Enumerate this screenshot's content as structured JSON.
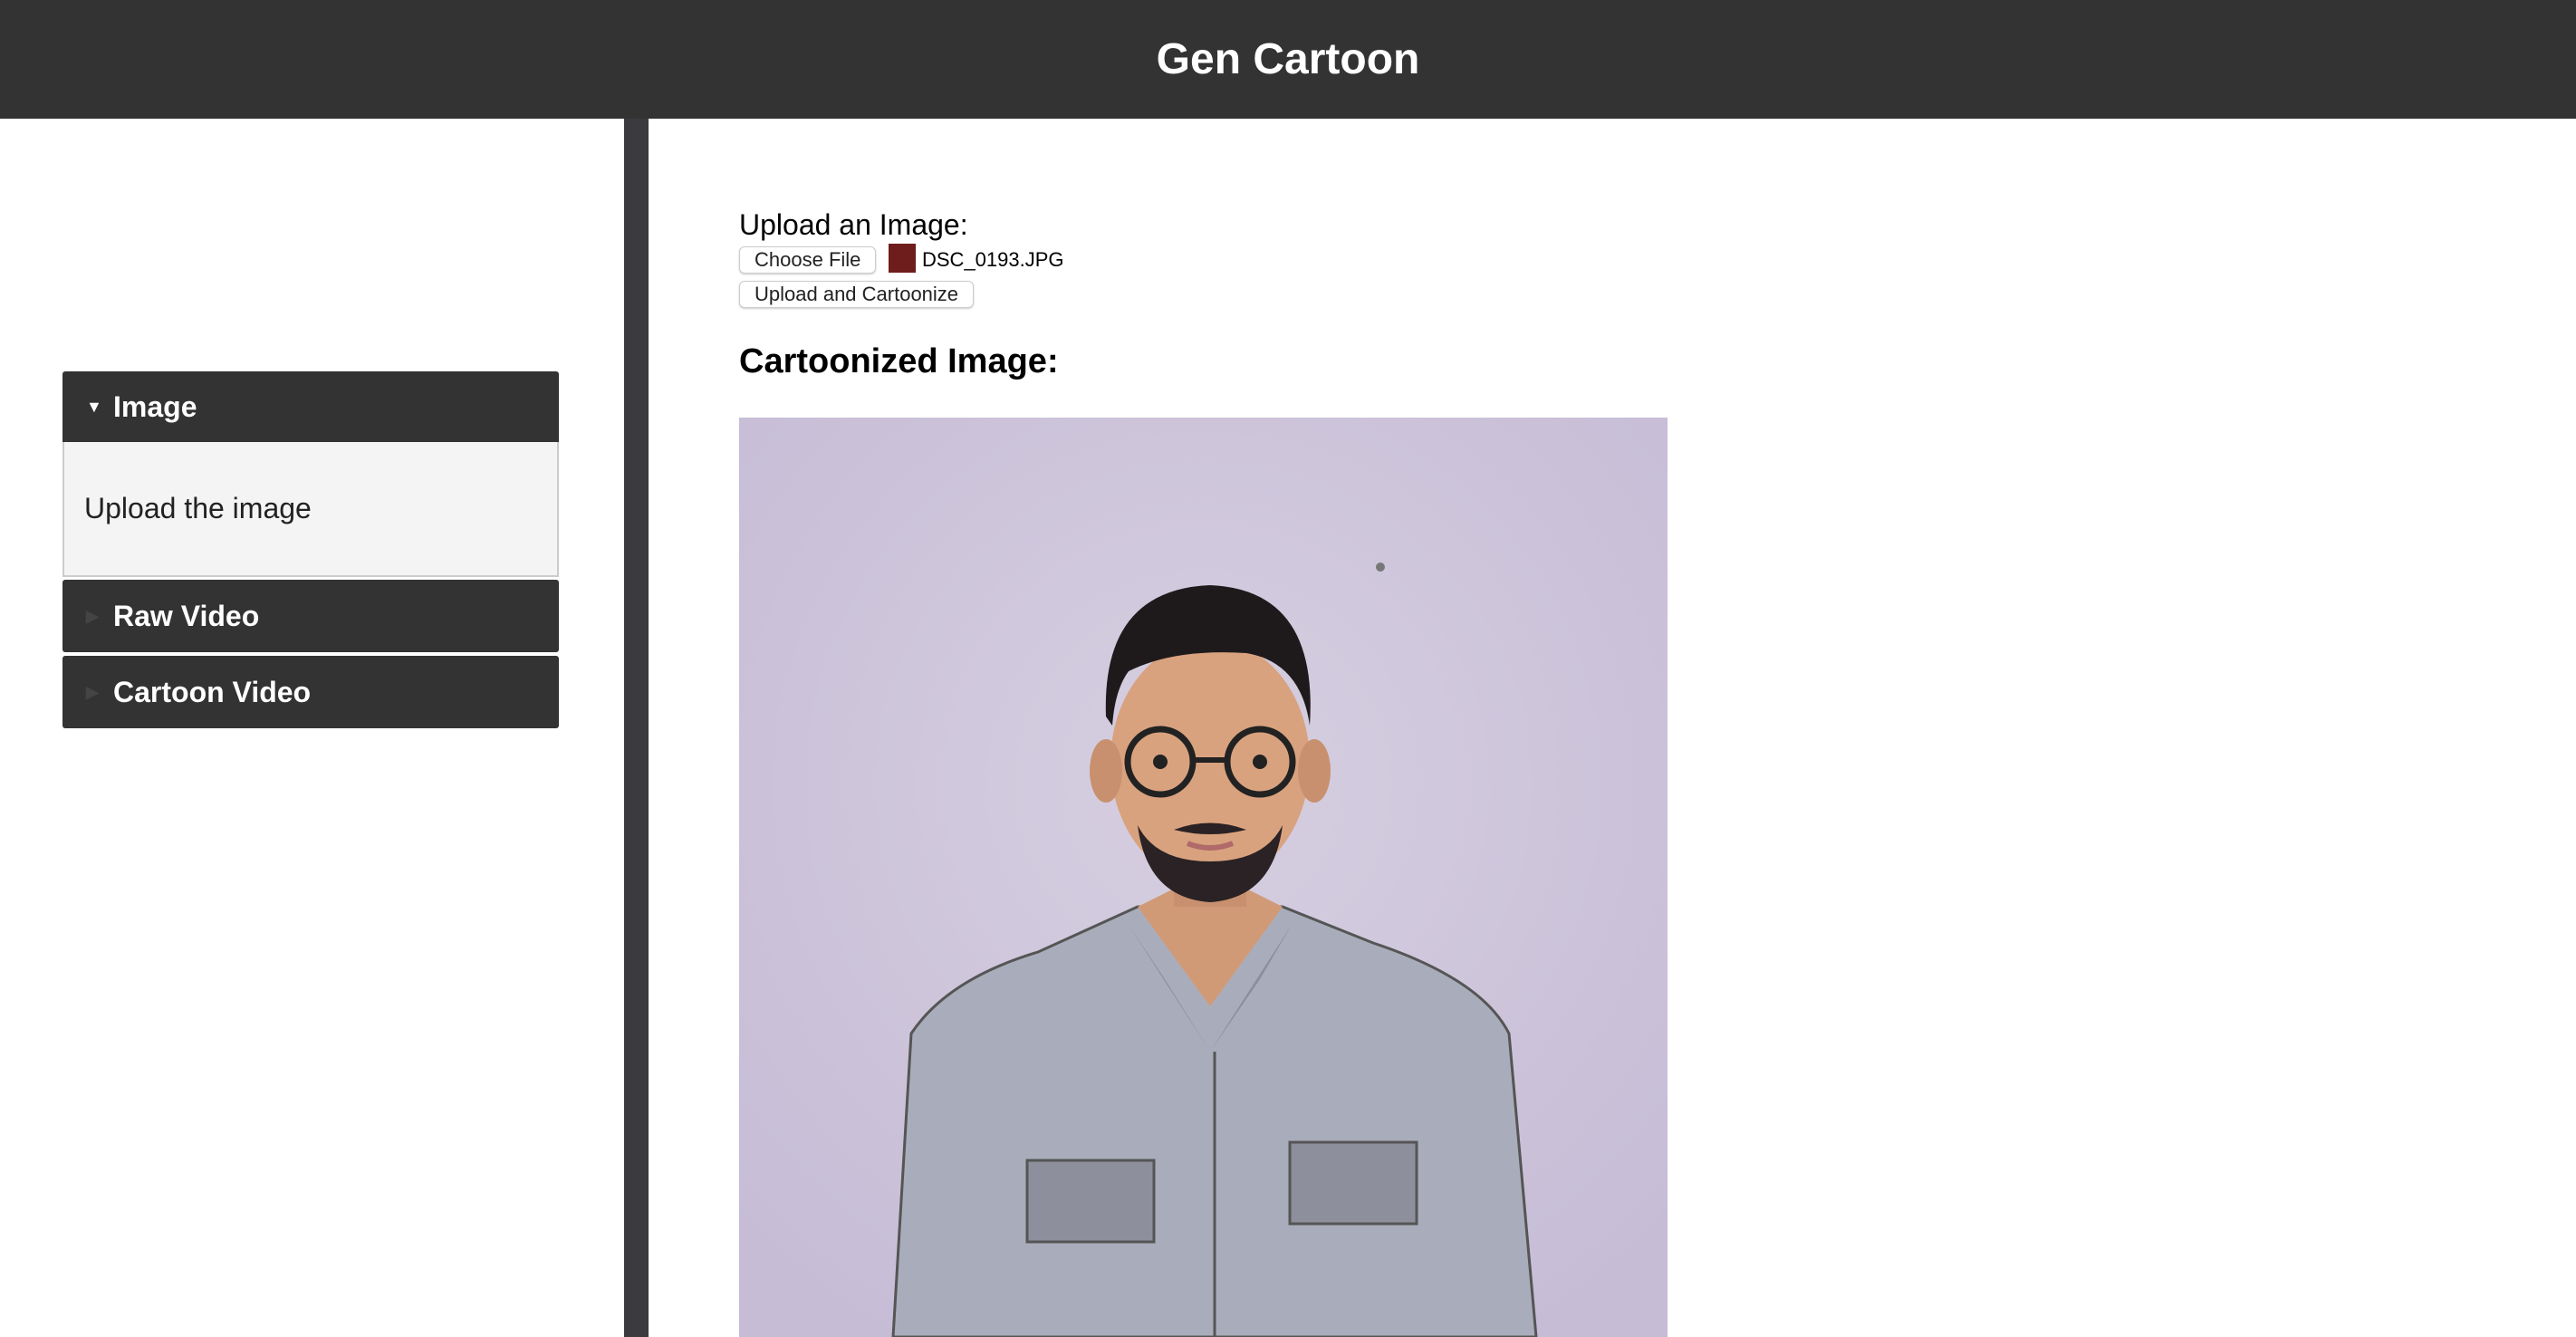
{
  "header": {
    "title": "Gen Cartoon"
  },
  "sidebar": {
    "items": [
      {
        "label": "Image",
        "expanded": true,
        "content": "Upload the image"
      },
      {
        "label": "Raw Video",
        "expanded": false
      },
      {
        "label": "Cartoon Video",
        "expanded": false
      }
    ]
  },
  "main": {
    "upload_label": "Upload an Image:",
    "choose_file_label": "Choose File",
    "file_name": "DSC_0193.JPG",
    "submit_label": "Upload and Cartoonize",
    "result_heading": "Cartoonized Image:"
  },
  "colors": {
    "header_bg": "#333333",
    "accent_swatch": "#6e1c1c",
    "image_bg": "#c9c0d8"
  }
}
